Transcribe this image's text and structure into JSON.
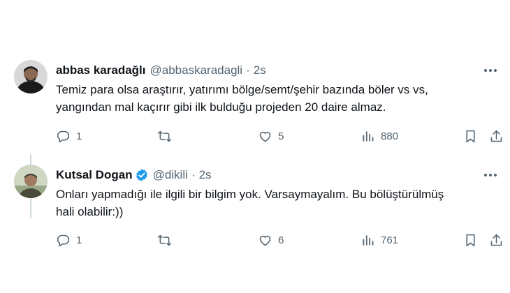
{
  "tweets": [
    {
      "author_name": "abbas karadağlı",
      "handle": "@abbaskaradagli",
      "separator": "·",
      "time": "2s",
      "verified": false,
      "text": "Temiz para olsa araştırır, yatırımı bölge/semt/şehir bazında böler vs vs,\nyangından mal kaçırır gibi ilk bulduğu projeden 20 daire almaz.",
      "replies": "1",
      "retweets": "",
      "likes": "5",
      "views": "880"
    },
    {
      "author_name": "Kutsal Dogan",
      "handle": "@dikili",
      "separator": "·",
      "time": "2s",
      "verified": true,
      "text": "Onları yapmadığı ile ilgili bir bilgim yok. Varsaymayalım. Bu bölüştürülmüş\nhali olabilir:))",
      "replies": "1",
      "retweets": "",
      "likes": "6",
      "views": "761"
    }
  ],
  "icons": {
    "reply": "reply-icon",
    "retweet": "retweet-icon",
    "like": "heart-icon",
    "views": "views-icon",
    "bookmark": "bookmark-icon",
    "share": "share-icon",
    "more": "more-icon",
    "verified": "verified-badge-icon"
  },
  "colors": {
    "text": "#0f1419",
    "secondary": "#536471",
    "verified": "#1d9bf0",
    "thread_line": "#cfd9de"
  }
}
